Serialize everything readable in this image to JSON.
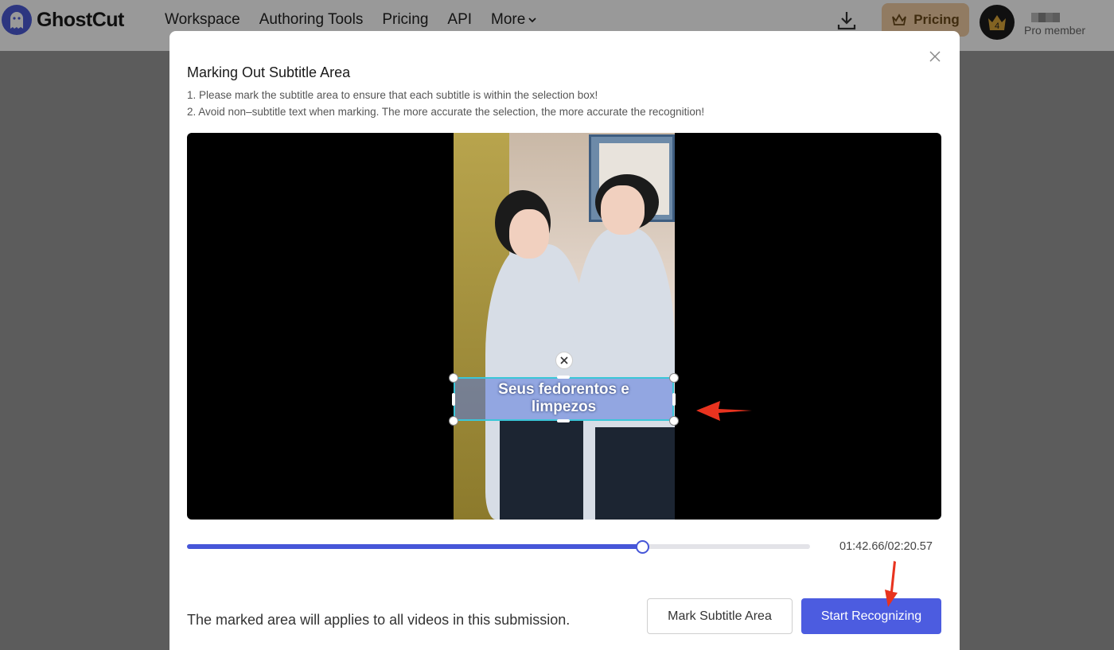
{
  "topbar": {
    "brand": "GhostCut",
    "nav": [
      "Workspace",
      "Authoring Tools",
      "Pricing",
      "API",
      "More"
    ],
    "pricing_button": "Pricing",
    "avatar_level": "4",
    "member_label": "Pro member"
  },
  "modal": {
    "title": "Marking Out Subtitle Area",
    "instruction_1": "1. Please mark the subtitle area to ensure that each subtitle is within the selection box!",
    "instruction_2": "2. Avoid non–subtitle text when marking. The more accurate the selection, the more accurate the recognition!",
    "subtitle_line_1": "Seus fedorentos e",
    "subtitle_line_2": "limpezos",
    "progress_fraction": 0.73,
    "timecode": "01:42.66/02:20.57",
    "note": "The marked area will applies to all videos in this submission.",
    "mark_button": "Mark Subtitle Area",
    "start_button": "Start Recognizing"
  },
  "colors": {
    "accent": "#4c5ce0",
    "selection_border": "#3bc6d8",
    "annotation_arrow": "#e8331f",
    "pricing_bg": "#f2cda4"
  }
}
